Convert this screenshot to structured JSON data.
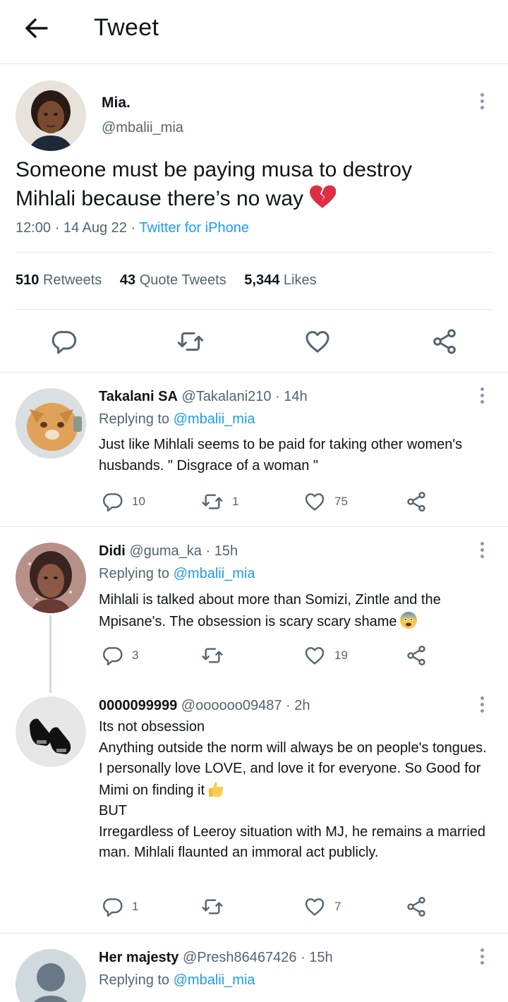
{
  "header": {
    "title": "Tweet"
  },
  "main_tweet": {
    "name": "Mia.",
    "handle": "@mbalii_mia",
    "text": "Someone must be paying musa to destroy Mihlali because there’s no way",
    "emoji": "broken-heart",
    "time_date": "12:00 · 14 Aug 22 · ",
    "source": "Twitter for iPhone",
    "stats": [
      {
        "count": "510",
        "label": "Retweets"
      },
      {
        "count": "43",
        "label": "Quote Tweets"
      },
      {
        "count": "5,344",
        "label": "Likes"
      }
    ]
  },
  "replies": [
    {
      "name": "Takalani SA",
      "handle": "@Takalani210",
      "time": "· 14h",
      "replying_prefix": "Replying to ",
      "replying_to": "@mbalii_mia",
      "text": "Just like Mihlali seems to be paid for taking other women's husbands. \" Disgrace of a woman \"",
      "replies_count": "10",
      "retweets_count": "1",
      "likes_count": "75"
    },
    {
      "name": "Didi",
      "handle": "@guma_ka",
      "time": "· 15h",
      "replying_prefix": "Replying to ",
      "replying_to": "@mbalii_mia",
      "text": "Mihlali is talked about more than Somizi, Zintle and the Mpisane's. The obsession is scary scary shame",
      "emoji": "fearful-face",
      "replies_count": "3",
      "retweets_count": "",
      "likes_count": "19"
    },
    {
      "name": "0000099999",
      "handle": "@oooooo09487",
      "time": "· 2h",
      "lines": [
        "Its not obsession",
        "Anything outside the norm will always be on people's tongues.",
        "I personally love LOVE, and love it for everyone. So Good for Mimi on finding it",
        "BUT",
        "Irregardless of Leeroy situation with MJ, he remains a married man. Mihlali flaunted an immoral act publicly."
      ],
      "emoji": "thumbs-up",
      "replies_count": "1",
      "retweets_count": "",
      "likes_count": "7"
    },
    {
      "name": "Her majesty",
      "handle": "@Presh86467426",
      "time": "· 15h",
      "replying_prefix": "Replying to ",
      "replying_to": "@mbalii_mia"
    }
  ],
  "colors": {
    "link": "#1d9bf0",
    "secondary_text": "#536471",
    "icon": "#536471"
  }
}
